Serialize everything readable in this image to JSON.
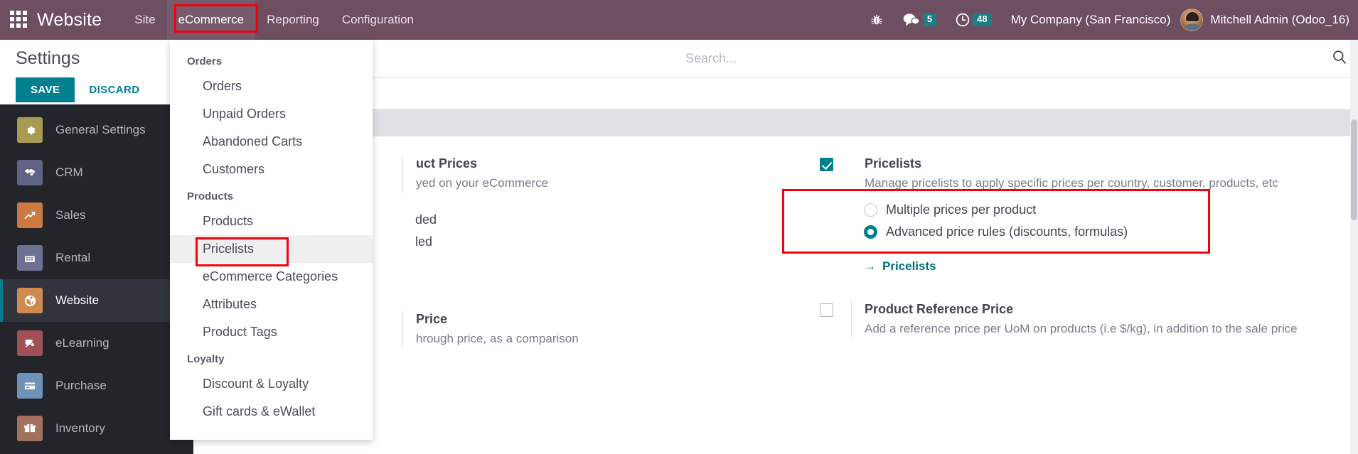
{
  "navbar": {
    "apps_icon": "apps-grid-icon",
    "brand": "Website",
    "menus": [
      {
        "label": "Site",
        "active": false
      },
      {
        "label": "eCommerce",
        "active": true
      },
      {
        "label": "Reporting",
        "active": false
      },
      {
        "label": "Configuration",
        "active": false
      }
    ],
    "debug_icon": "bug-icon",
    "messages_icon": "chat-bubble-icon",
    "messages_count": "5",
    "activities_icon": "clock-icon",
    "activities_count": "48",
    "company": "My Company (San Francisco)",
    "avatar_icon": "user-avatar",
    "user": "Mitchell Admin (Odoo_16)"
  },
  "dropdown": {
    "sections": [
      {
        "title": "Orders",
        "items": [
          {
            "label": "Orders",
            "hovered": false
          },
          {
            "label": "Unpaid Orders",
            "hovered": false
          },
          {
            "label": "Abandoned Carts",
            "hovered": false
          },
          {
            "label": "Customers",
            "hovered": false
          }
        ]
      },
      {
        "title": "Products",
        "items": [
          {
            "label": "Products",
            "hovered": false
          },
          {
            "label": "Pricelists",
            "hovered": true
          },
          {
            "label": "eCommerce Categories",
            "hovered": false
          },
          {
            "label": "Attributes",
            "hovered": false
          },
          {
            "label": "Product Tags",
            "hovered": false
          }
        ]
      },
      {
        "title": "Loyalty",
        "items": [
          {
            "label": "Discount & Loyalty",
            "hovered": false
          },
          {
            "label": "Gift cards & eWallet",
            "hovered": false
          }
        ]
      }
    ]
  },
  "sidebar": {
    "title": "Settings",
    "save_label": "SAVE",
    "discard_label": "DISCARD",
    "items": [
      {
        "label": "General Settings",
        "icon": "gear-icon",
        "glyph": "⚙",
        "color": "#a99a52",
        "active": false
      },
      {
        "label": "CRM",
        "icon": "handshake-icon",
        "glyph": "ᾑD",
        "color": "#5f6386",
        "active": false
      },
      {
        "label": "Sales",
        "icon": "chart-line-icon",
        "glyph": "↗",
        "color": "#cc7a42",
        "active": false
      },
      {
        "label": "Rental",
        "icon": "calendar-icon",
        "glyph": "▤",
        "color": "#6d7293",
        "active": false
      },
      {
        "label": "Website",
        "icon": "globe-icon",
        "glyph": "ἱ0",
        "color": "#d08a4e",
        "active": true
      },
      {
        "label": "eLearning",
        "icon": "elearning-icon",
        "glyph": "⚑",
        "color": "#a15057",
        "active": false
      },
      {
        "label": "Purchase",
        "icon": "credit-card-icon",
        "glyph": "▭",
        "color": "#6f93b8",
        "active": false
      },
      {
        "label": "Inventory",
        "icon": "box-icon",
        "glyph": "✉",
        "color": "#a4705e",
        "active": false
      }
    ]
  },
  "search": {
    "value": "",
    "placeholder": "Search...",
    "icon": "search-icon"
  },
  "main": {
    "left_column": [
      {
        "title_visible_fragment": "uct Prices",
        "full_title": "Product Prices",
        "desc_visible_fragment": "yed on your eCommerce",
        "full_desc": "Prices displayed on your eCommerce",
        "radios": [
          {
            "label_fragment": "ded",
            "full_label": "Tax Excluded",
            "selected": true
          },
          {
            "label_fragment": "led",
            "full_label": "Tax Included",
            "selected": false
          }
        ]
      },
      {
        "title_visible_fragment": " Price",
        "full_title": "Comparison Price",
        "desc_visible_fragment": "hrough price, as a comparison",
        "full_desc": "Add a strikethrough price, as a comparison"
      }
    ],
    "right_column": [
      {
        "name": "pricelists",
        "title": "Pricelists",
        "desc": "Manage pricelists to apply specific prices per country, customer, products, etc",
        "checked": true,
        "highlighted": true,
        "radios": [
          {
            "label": "Multiple prices per product",
            "selected": false
          },
          {
            "label": "Advanced price rules (discounts, formulas)",
            "selected": true
          }
        ],
        "link": {
          "label": "Pricelists",
          "icon": "arrow-right-icon",
          "glyph": "→"
        }
      },
      {
        "name": "product-reference-price",
        "title": "Product Reference Price",
        "desc": "Add a reference price per UoM on products (i.e $/kg), in addition to the sale price",
        "checked": false,
        "highlighted": false
      }
    ]
  },
  "annotations": {
    "accent_red": "#f5000b",
    "boxes": [
      {
        "target": "ecommerce-menu"
      },
      {
        "target": "pricelists-menu-item"
      },
      {
        "target": "pricelists-setting-card"
      }
    ]
  },
  "colors": {
    "navbar_bg": "#6d4f61",
    "sidebar_bg": "#23252b",
    "accent_teal": "#00808f",
    "badge_teal": "#1a7f86"
  }
}
